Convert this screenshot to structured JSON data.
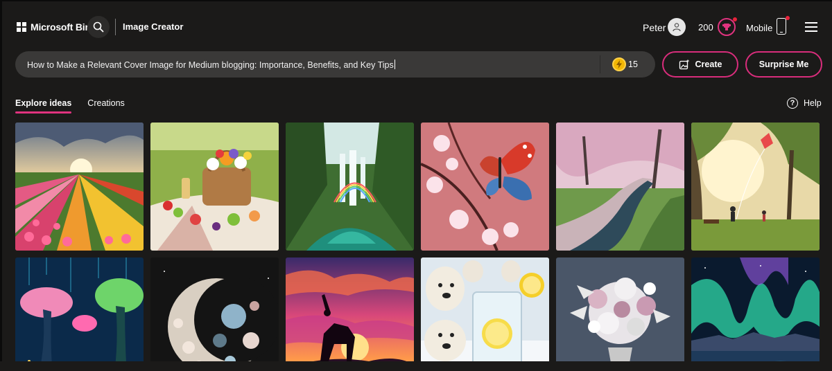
{
  "header": {
    "brand": "Microsoft Bing",
    "app_title": "Image Creator",
    "user_name": "Peter",
    "points": "200",
    "mobile_label": "Mobile",
    "icons": [
      "microsoft-logo-icon",
      "search-icon",
      "avatar-icon",
      "rewards-icon",
      "phone-icon",
      "menu-icon"
    ]
  },
  "prompt": {
    "value": "How to Make a Relevant Cover Image for Medium blogging: Importance, Benefits, and Key Tips",
    "boosts": "15"
  },
  "actions": {
    "create_label": "Create",
    "surprise_label": "Surprise Me"
  },
  "tabs": [
    {
      "label": "Explore ideas",
      "active": true
    },
    {
      "label": "Creations",
      "active": false
    }
  ],
  "help_label": "Help",
  "colors": {
    "background": "#1b1a19",
    "accent": "#e0337f",
    "input": "#3a3938",
    "coin": "#f2b705"
  },
  "gallery": [
    {
      "name": "tulip-field-sunset-image"
    },
    {
      "name": "picnic-basket-flowers-image"
    },
    {
      "name": "jungle-waterfall-rainbow-image"
    },
    {
      "name": "butterfly-cherry-blossom-image"
    },
    {
      "name": "cherry-blossom-stream-image"
    },
    {
      "name": "park-kite-children-image"
    },
    {
      "name": "neon-fantasy-forest-image"
    },
    {
      "name": "floral-crescent-moon-image"
    },
    {
      "name": "horse-rider-sunset-image"
    },
    {
      "name": "polar-bears-lemonade-image"
    },
    {
      "name": "white-flower-bouquet-image"
    },
    {
      "name": "aurora-borealis-image"
    }
  ]
}
